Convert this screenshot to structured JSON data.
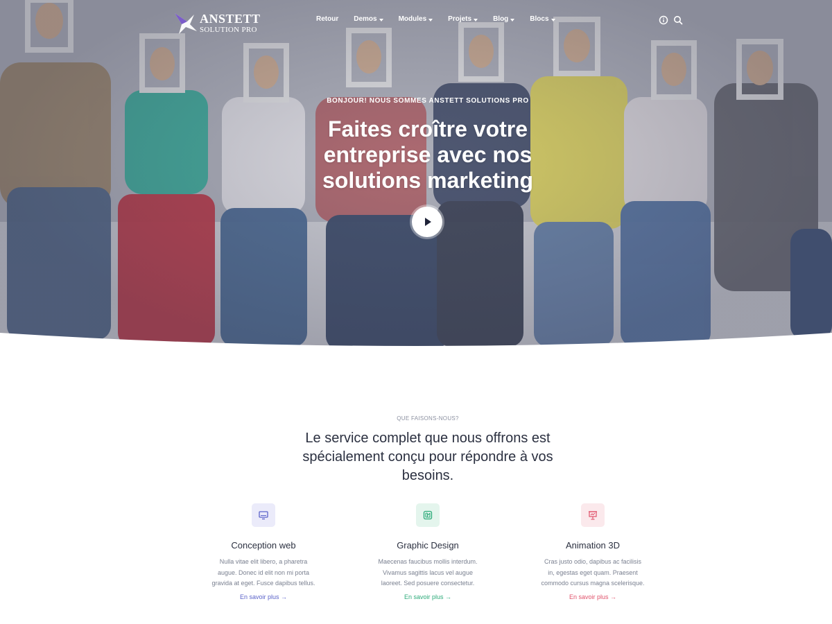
{
  "brand": {
    "name": "ANSTETT",
    "tagline": "SOLUTION PRO"
  },
  "nav": {
    "items": [
      {
        "label": "Retour",
        "dropdown": false
      },
      {
        "label": "Demos",
        "dropdown": true
      },
      {
        "label": "Modules",
        "dropdown": true
      },
      {
        "label": "Projets",
        "dropdown": true
      },
      {
        "label": "Blog",
        "dropdown": true
      },
      {
        "label": "Blocs",
        "dropdown": true
      }
    ],
    "icons": [
      "info-icon",
      "search-icon"
    ]
  },
  "hero": {
    "eyebrow": "BONJOUR! NOUS SOMMES ANSTETT SOLUTIONS PRO",
    "headline_lines": [
      "Faites croître votre",
      "entreprise avec nos",
      "solutions marketing"
    ],
    "play_icon": "play-icon"
  },
  "services": {
    "eyebrow": "QUE FAISONS-NOUS?",
    "title": "Le service complet que nous offrons est spécialement conçu pour répondre à vos besoins.",
    "cards": [
      {
        "icon": "monitor-icon",
        "title": "Conception web",
        "text": "Nulla vitae elit libero, a pharetra augue. Donec id elit non mi porta gravida at eget. Fusce dapibus tellus.",
        "link": "En savoir plus →",
        "accent": "#5b63c9",
        "icon_bg": "#ebebfa"
      },
      {
        "icon": "palette-icon",
        "title": "Graphic Design",
        "text": "Maecenas faucibus mollis interdum. Vivamus sagittis lacus vel augue laoreet. Sed posuere consectetur.",
        "link": "En savoir plus →",
        "accent": "#2dab7a",
        "icon_bg": "#e4f5ed"
      },
      {
        "icon": "presentation-icon",
        "title": "Animation 3D",
        "text": "Cras justo odio, dapibus ac facilisis in, egestas eget quam. Praesent commodo cursus magna scelerisque.",
        "link": "En savoir plus →",
        "accent": "#e0526b",
        "icon_bg": "#fbe9ec"
      }
    ]
  }
}
